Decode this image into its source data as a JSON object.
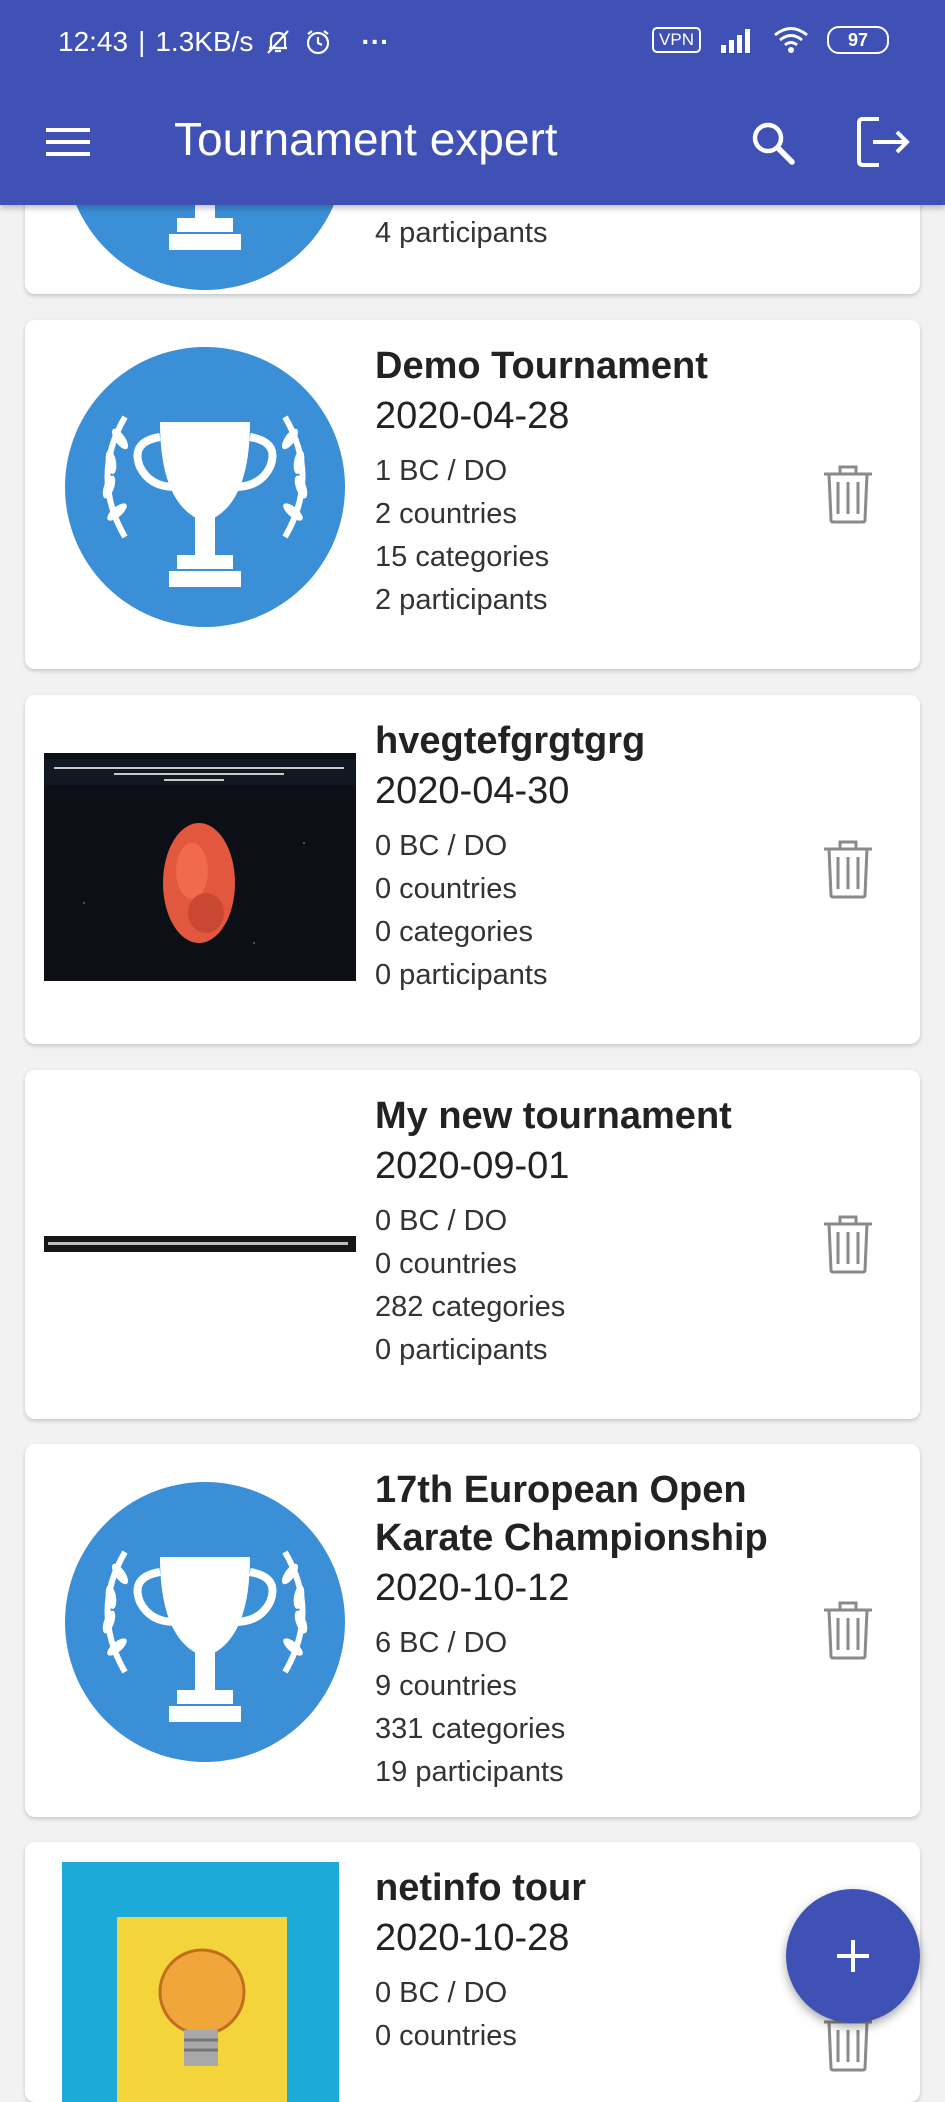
{
  "status_bar": {
    "time": "12:43",
    "network_speed": "1.3KB/s",
    "overflow_dots": "···",
    "vpn_label": "VPN",
    "battery_level": "97"
  },
  "toolbar": {
    "title": "Tournament expert",
    "icons": [
      "menu-icon",
      "search-icon",
      "logout-icon"
    ]
  },
  "tournaments": [
    {
      "name": "",
      "date": "",
      "bc": "",
      "countries": "",
      "categories": "",
      "participants": "4 participants",
      "image": "trophy"
    },
    {
      "name": "Demo Tournament",
      "date": "2020-04-28",
      "bc": "1 BC / DO",
      "countries": "2 countries",
      "categories": "15 categories",
      "participants": "2 participants",
      "image": "trophy"
    },
    {
      "name": "hvegtefgrgtgrg",
      "date": "2020-04-30",
      "bc": "0 BC / DO",
      "countries": "0 countries",
      "categories": "0 categories",
      "participants": "0 participants",
      "image": "photo-orange-blob"
    },
    {
      "name": "My new tournament",
      "date": "2020-09-01",
      "bc": "0 BC / DO",
      "countries": "0 countries",
      "categories": "282 categories",
      "participants": "0 participants",
      "image": "terminal-strip"
    },
    {
      "name": "17th European Open Karate Championship",
      "date": "2020-10-12",
      "bc": "6 BC / DO",
      "countries": "9 countries",
      "categories": "331 categories",
      "participants": "19 participants",
      "image": "trophy"
    },
    {
      "name": "netinfo tour",
      "date": "2020-10-28",
      "bc": "0 BC / DO",
      "countries": "0 countries",
      "categories": "",
      "participants": "",
      "image": "lightbulb"
    }
  ],
  "fab": {
    "icon": "plus-icon"
  },
  "colors": {
    "primary": "#3f51b5",
    "trophy_blue": "#3b8fd6",
    "trash_grey": "#8a8a8a"
  }
}
